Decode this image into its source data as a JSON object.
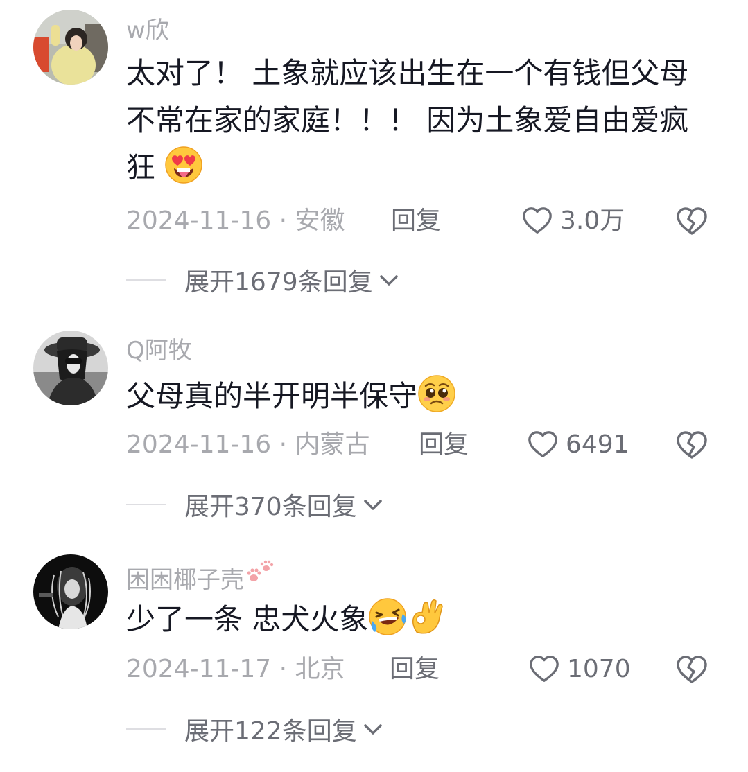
{
  "comments": [
    {
      "username": "w欣",
      "text": "太对了！ 土象就应该出生在一个有钱但父母不常在家的家庭！！！ 因为土象爱自由爱疯狂",
      "emojis": [
        "heart-eyes-tongue-emoji"
      ],
      "date_location": "2024-11-16 · 安徽",
      "reply_label": "回复",
      "likes": "3.0万",
      "expand_label": "展开1679条回复"
    },
    {
      "username": "Q阿牧",
      "text": "父母真的半开明半保守",
      "emojis": [
        "pleading-face-emoji"
      ],
      "date_location": "2024-11-16 · 内蒙古",
      "reply_label": "回复",
      "likes": "6491",
      "expand_label": "展开370条回复"
    },
    {
      "username": "困困椰子壳",
      "text": "少了一条 忠犬火象",
      "emojis": [
        "rolling-laughing-emoji",
        "ok-hand-emoji",
        "paw-prints-emoji"
      ],
      "date_location": "2024-11-17 · 北京",
      "reply_label": "回复",
      "likes": "1070",
      "expand_label": "展开122条回复"
    }
  ],
  "icons": {
    "like": "heart-outline-icon",
    "dislike": "broken-heart-icon",
    "expand": "chevron-down-icon"
  },
  "colors": {
    "username": "#a8a9ae",
    "text": "#161823",
    "meta": "#a8a9ae",
    "action": "#6b6d75",
    "divider": "#dedee2"
  }
}
